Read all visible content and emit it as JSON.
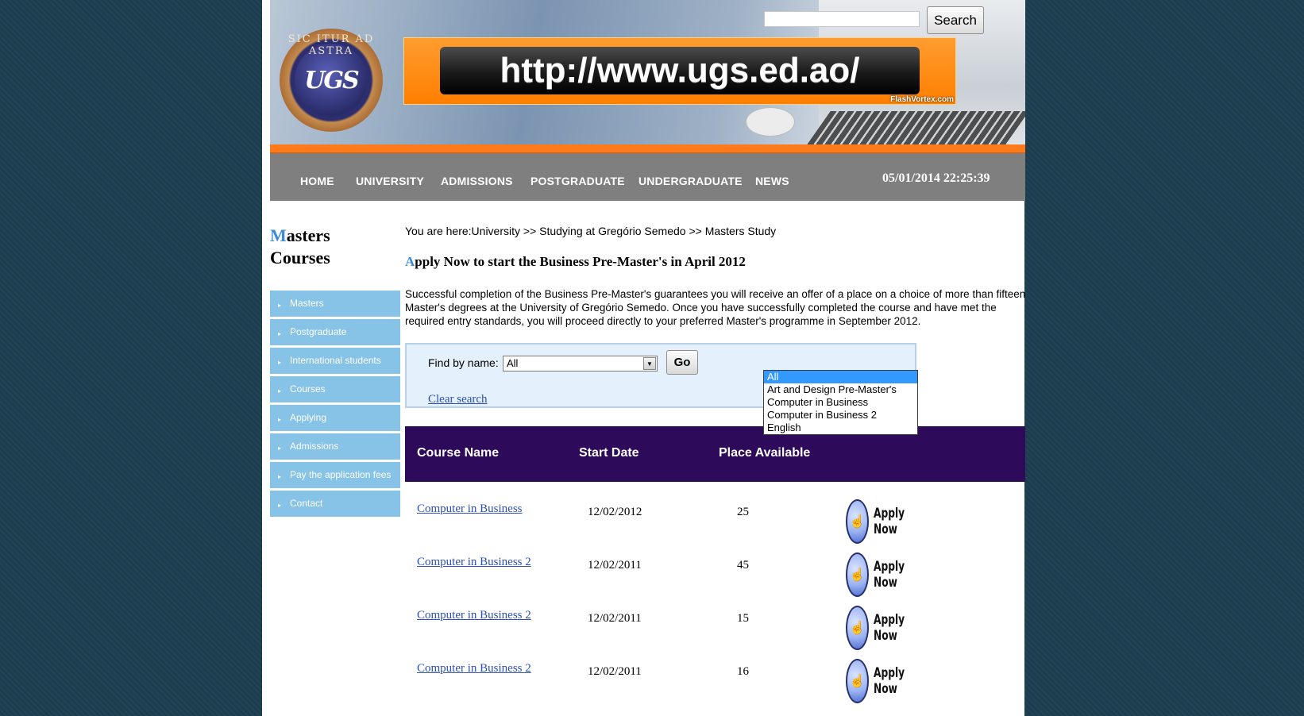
{
  "header": {
    "logo_motto": "SIC ITUR AD ASTRA",
    "logo_initials": "UGS",
    "banner_url": "http://www.ugs.ed.ao/",
    "banner_credit": "FlashVortex.com",
    "search": {
      "button_label": "Search",
      "value": ""
    }
  },
  "nav": {
    "items": [
      {
        "label": "HOME"
      },
      {
        "label": "UNIVERSITY"
      },
      {
        "label": "ADMISSIONS"
      },
      {
        "label": "POSTGRADUATE"
      },
      {
        "label": "UNDERGRADUATE"
      },
      {
        "label": "NEWS"
      }
    ],
    "datetime": "05/01/2014 22:25:39"
  },
  "sidebar": {
    "title_cap": "M",
    "title_rest_1": "asters",
    "title_line_2": "Courses",
    "items": [
      {
        "label": "Masters"
      },
      {
        "label": "Postgraduate"
      },
      {
        "label": "International students"
      },
      {
        "label": "Courses"
      },
      {
        "label": "Applying"
      },
      {
        "label": "Admissions"
      },
      {
        "label": "Pay the application fees"
      },
      {
        "label": "Contact"
      }
    ]
  },
  "main": {
    "breadcrumb": "You are here:University >> Studying at Gregório Semedo >> Masters Study",
    "title_cap": "A",
    "title_rest": "pply Now to start the Business Pre-Master's in April 2012",
    "intro": "Successful completion of the Business Pre-Master's guarantees you will receive an offer of a place on a choice of more than fifteen Master's degrees at the University of Gregório Semedo. Once you have successfully completed the course and have met the required entry standards, you will proceed directly to your preferred Master's programme in September 2012.",
    "find": {
      "label": "Find by name:",
      "selected": "All",
      "go_label": "Go",
      "clear_label": "Clear search",
      "options": [
        "All",
        "Art and Design Pre-Master's",
        "Computer in Business",
        "Computer in Business 2",
        "English"
      ]
    },
    "table": {
      "headers": [
        "Course Name",
        "Start Date",
        "Place Available"
      ],
      "apply_label": "Apply Now",
      "rows": [
        {
          "course": "Computer in Business",
          "date": "12/02/2012",
          "places": "25"
        },
        {
          "course": "Computer in Business 2",
          "date": "12/02/2011",
          "places": "45"
        },
        {
          "course": "Computer in Business 2",
          "date": "12/02/2011",
          "places": "15"
        },
        {
          "course": "Computer in Business 2",
          "date": "12/02/2011",
          "places": "16"
        }
      ]
    }
  },
  "colors": {
    "nav_bg": "#7f7f7f",
    "orange_accent": "#ff7a1a",
    "table_header_bg": "#2d0b5a",
    "sidebar_item_bg": "#86c3e6",
    "link": "#2c4fb8"
  }
}
